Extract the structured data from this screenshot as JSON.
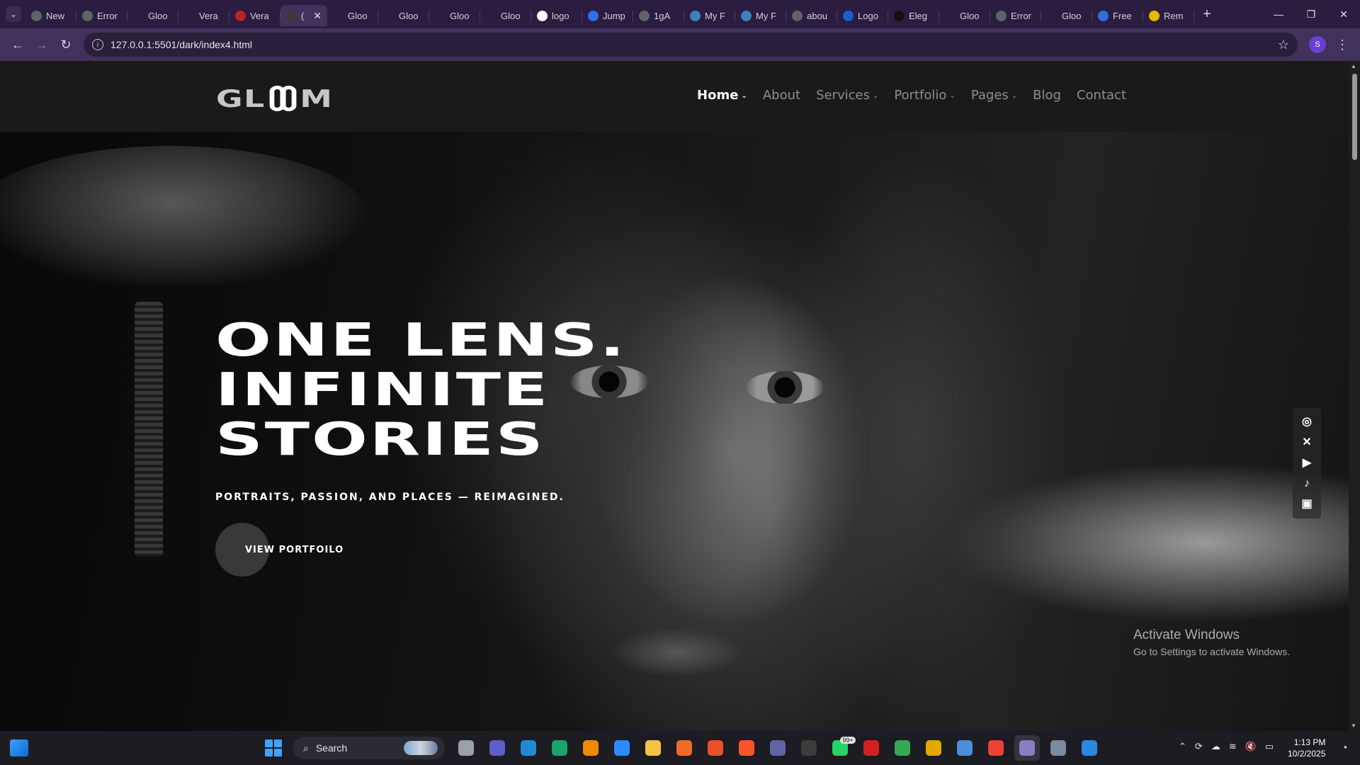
{
  "browser": {
    "tabs": [
      {
        "title": "New",
        "icon": "chrome-icon",
        "color": "#5f6368"
      },
      {
        "title": "Error",
        "icon": "globe-icon",
        "color": "#5f6368"
      },
      {
        "title": "Gloo",
        "icon": "site-icon",
        "color": "#2a1d3f"
      },
      {
        "title": "Vera",
        "icon": "site-icon",
        "color": "#2a1d3f"
      },
      {
        "title": "Vera",
        "icon": "vera-icon",
        "color": "#c0202a"
      },
      {
        "title": "(",
        "icon": "site-icon",
        "color": "#3a3a3a",
        "active": true
      },
      {
        "title": "Gloo",
        "icon": "site-icon",
        "color": "#2a1d3f"
      },
      {
        "title": "Gloo",
        "icon": "site-icon",
        "color": "#2a1d3f"
      },
      {
        "title": "Gloo",
        "icon": "site-icon",
        "color": "#2a1d3f"
      },
      {
        "title": "Gloo",
        "icon": "site-icon",
        "color": "#2a1d3f"
      },
      {
        "title": "logo",
        "icon": "google-icon",
        "color": "#ffffff"
      },
      {
        "title": "Jump",
        "icon": "jump-icon",
        "color": "#2d6ff0"
      },
      {
        "title": "1gA",
        "icon": "globe-icon",
        "color": "#5f6368"
      },
      {
        "title": "My F",
        "icon": "myf-icon",
        "color": "#3d7fc0"
      },
      {
        "title": "My F",
        "icon": "myf-icon",
        "color": "#3d7fc0"
      },
      {
        "title": "abou",
        "icon": "globe-icon",
        "color": "#5f6368"
      },
      {
        "title": "Logo",
        "icon": "logo-icon",
        "color": "#1a5fd0"
      },
      {
        "title": "Eleg",
        "icon": "eleg-icon",
        "color": "#111111"
      },
      {
        "title": "Gloo",
        "icon": "site-icon",
        "color": "#2a1d3f"
      },
      {
        "title": "Error",
        "icon": "globe-icon",
        "color": "#5f6368"
      },
      {
        "title": "Gloo",
        "icon": "site-icon",
        "color": "#2a1d3f"
      },
      {
        "title": "Free",
        "icon": "free-icon",
        "color": "#2f6fe0"
      },
      {
        "title": "Rem",
        "icon": "rem-icon",
        "color": "#e6b800"
      }
    ],
    "url": "127.0.0.1:5501/dark/index4.html",
    "profile_initial": "S"
  },
  "site": {
    "logo_left": "GL",
    "logo_right": "M",
    "nav": [
      {
        "label": "Home",
        "dropdown": true,
        "active": true
      },
      {
        "label": "About",
        "dropdown": false
      },
      {
        "label": "Services",
        "dropdown": true
      },
      {
        "label": "Portfolio",
        "dropdown": true
      },
      {
        "label": "Pages",
        "dropdown": true
      },
      {
        "label": "Blog",
        "dropdown": false
      },
      {
        "label": "Contact",
        "dropdown": false
      }
    ],
    "hero": {
      "headline": [
        "ONE LENS.",
        "INFINITE",
        "STORIES"
      ],
      "subheadline": "PORTRAITS, PASSION, AND PLACES — REIMAGINED.",
      "cta": "VIEW PORTFOILO"
    },
    "social": [
      "instagram-icon",
      "x-icon",
      "youtube-icon",
      "tiktok-icon",
      "discord-icon"
    ]
  },
  "watermark": {
    "title": "Activate Windows",
    "subtitle": "Go to Settings to activate Windows."
  },
  "taskbar": {
    "search_label": "Search",
    "apps": [
      {
        "name": "task-view-icon",
        "color": "#9aa0aa"
      },
      {
        "name": "meet-icon",
        "color": "#5b5fc7"
      },
      {
        "name": "vscode-icon",
        "color": "#1f8ad2"
      },
      {
        "name": "edge-icon",
        "color": "#1aa36b"
      },
      {
        "name": "vlc-icon",
        "color": "#f08a00"
      },
      {
        "name": "zoom-icon",
        "color": "#2d8cff"
      },
      {
        "name": "explorer-icon",
        "color": "#f5c542"
      },
      {
        "name": "pen-icon",
        "color": "#f06a2a"
      },
      {
        "name": "app-icon",
        "color": "#e8502a"
      },
      {
        "name": "brave-icon",
        "color": "#fb542b"
      },
      {
        "name": "teams-icon",
        "color": "#6264a7"
      },
      {
        "name": "media-player-icon",
        "color": "#3c3c3c"
      },
      {
        "name": "whatsapp-icon",
        "color": "#25d366",
        "badge": "99+"
      },
      {
        "name": "flash-icon",
        "color": "#d42020"
      },
      {
        "name": "chrome-icon",
        "color": "#34a853"
      },
      {
        "name": "coin-icon",
        "color": "#e0a800"
      },
      {
        "name": "remote-icon",
        "color": "#4a90d9"
      },
      {
        "name": "chrome-icon",
        "color": "#ea4335"
      },
      {
        "name": "chrome-icon",
        "color": "#8e7cc3",
        "active": true
      },
      {
        "name": "keyboard-icon",
        "color": "#7a8aa0"
      },
      {
        "name": "paint-icon",
        "color": "#2a88e0"
      }
    ],
    "time": "1:13 PM",
    "date": "10/2/2025"
  }
}
